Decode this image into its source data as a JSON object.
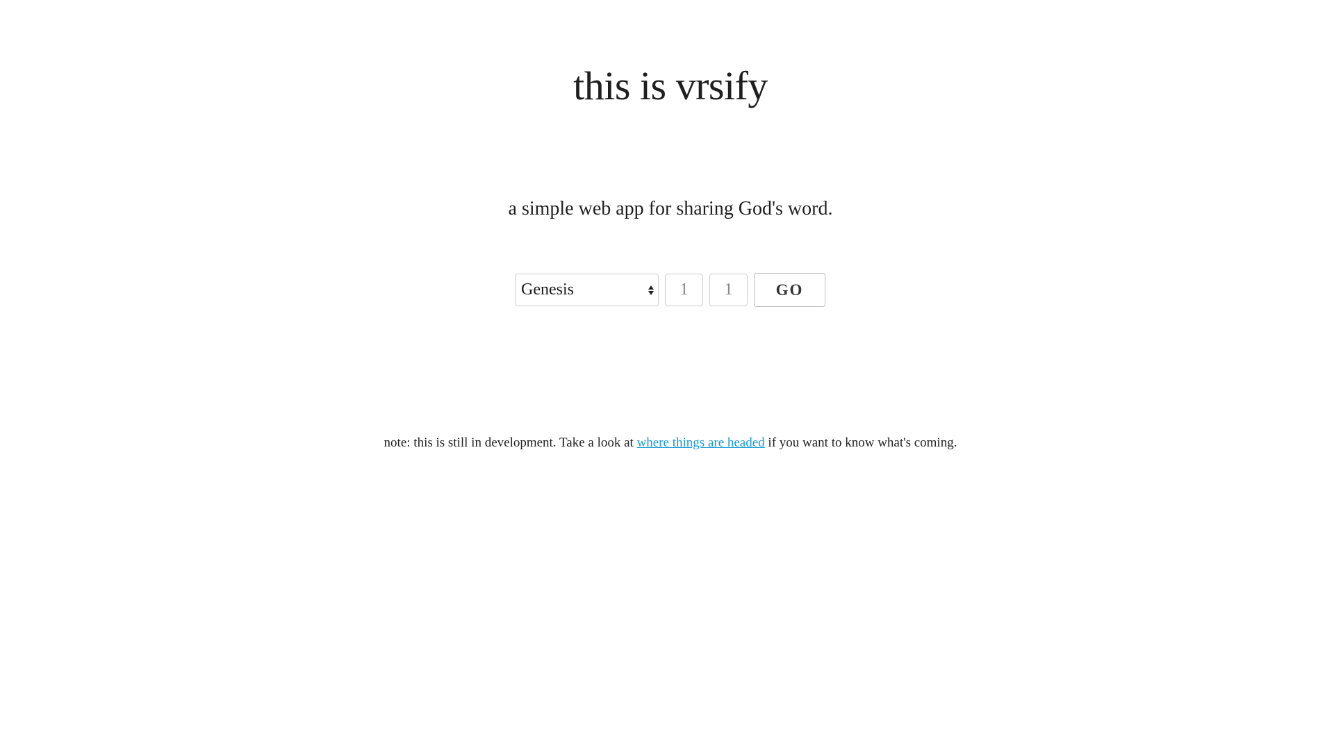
{
  "header": {
    "title": "this is vrsify"
  },
  "main": {
    "tagline": "a simple web app for sharing God's word.",
    "form": {
      "book": {
        "selected": "Genesis"
      },
      "chapter": {
        "placeholder": "1"
      },
      "verse": {
        "placeholder": "1"
      },
      "go_label": "GO"
    }
  },
  "footer": {
    "note_prefix": "note: this is still in development. Take a look at",
    "link_text": "where things are headed",
    "note_suffix": "if you want to know what's coming."
  },
  "colors": {
    "link": "#1a9bd1",
    "text": "#1f1f1f",
    "border": "#cfcfcf"
  }
}
